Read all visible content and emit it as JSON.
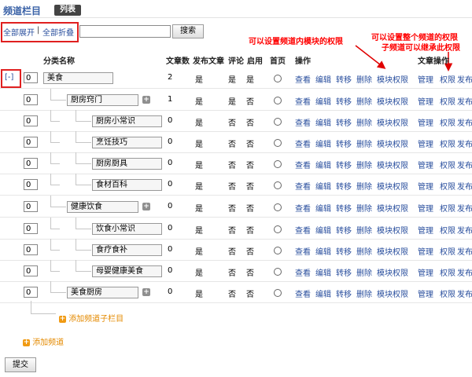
{
  "header": {
    "title": "频道栏目",
    "tab_label": "列表"
  },
  "toolbar": {
    "expand_all": "全部展开",
    "separator": "|",
    "collapse_all": "全部折叠",
    "search_value": "",
    "search_button": "搜索"
  },
  "annotations": {
    "module_permission": "可以设置频道内模块的权限",
    "channel_permission_line1": "可以设置整个频道的权限",
    "channel_permission_line2": "子频道可以继承此权限"
  },
  "columns": {
    "name": "分类名称",
    "article_count": "文章数",
    "publish_article": "发布文章",
    "comment": "评论",
    "enabled": "启用",
    "homepage": "首页",
    "operations": "操作",
    "article_operations": "文章操作"
  },
  "tree_toggle": "[-]",
  "rows": [
    {
      "order": "0",
      "name": "美食",
      "count": "2",
      "publish": "是",
      "comment": "是",
      "enabled": "是"
    },
    {
      "order": "0",
      "name": "厨房窍门",
      "count": "1",
      "publish": "是",
      "comment": "是",
      "enabled": "否"
    },
    {
      "order": "0",
      "name": "厨房小常识",
      "count": "0",
      "publish": "是",
      "comment": "否",
      "enabled": "否"
    },
    {
      "order": "0",
      "name": "烹饪技巧",
      "count": "0",
      "publish": "是",
      "comment": "否",
      "enabled": "否"
    },
    {
      "order": "0",
      "name": "厨房厨具",
      "count": "0",
      "publish": "是",
      "comment": "否",
      "enabled": "否"
    },
    {
      "order": "0",
      "name": "食材百科",
      "count": "0",
      "publish": "是",
      "comment": "否",
      "enabled": "否"
    },
    {
      "order": "0",
      "name": "健康饮食",
      "count": "0",
      "publish": "是",
      "comment": "否",
      "enabled": "否"
    },
    {
      "order": "0",
      "name": "饮食小常识",
      "count": "0",
      "publish": "是",
      "comment": "否",
      "enabled": "否"
    },
    {
      "order": "0",
      "name": "食疗食补",
      "count": "0",
      "publish": "是",
      "comment": "否",
      "enabled": "否"
    },
    {
      "order": "0",
      "name": "母婴健康美食",
      "count": "0",
      "publish": "是",
      "comment": "否",
      "enabled": "否"
    },
    {
      "order": "0",
      "name": "美食厨房",
      "count": "0",
      "publish": "是",
      "comment": "否",
      "enabled": "否"
    }
  ],
  "actions": {
    "view": "查看",
    "edit": "编辑",
    "move": "转移",
    "delete": "删除",
    "module_permission": "模块权限",
    "manage": "管理",
    "permission": "权限",
    "publish": "发布"
  },
  "add_subchannel": "添加频道子栏目",
  "add_channel": "添加频道",
  "submit_button": "提交",
  "colors": {
    "title_blue": "#3a62a7",
    "link_blue": "#2a4f9e",
    "annotation_red": "#ff0000",
    "add_orange": "#e48a00"
  }
}
